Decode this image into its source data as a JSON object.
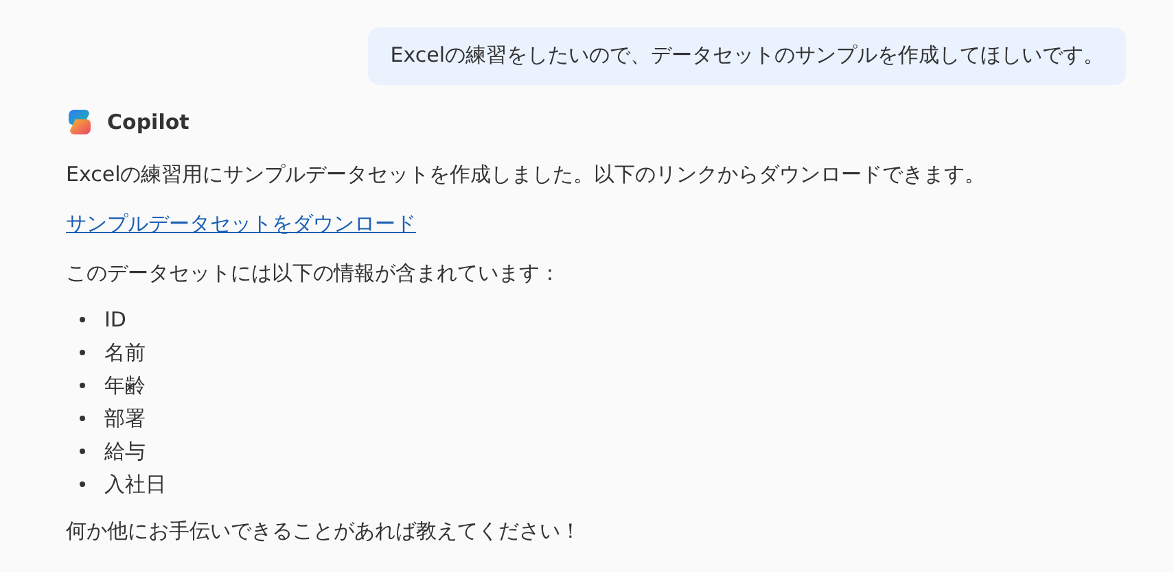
{
  "user_message": "Excelの練習をしたいので、データセットのサンプルを作成してほしいです。",
  "assistant": {
    "name": "Copilot",
    "intro": "Excelの練習用にサンプルデータセットを作成しました。以下のリンクからダウンロードできます。",
    "link": "サンプルデータセットをダウンロード",
    "list_heading": "このデータセットには以下の情報が含まれています：",
    "items": [
      "ID",
      "名前",
      "年齢",
      "部署",
      "給与",
      "入社日"
    ],
    "closing": "何か他にお手伝いできることがあれば教えてください！"
  }
}
